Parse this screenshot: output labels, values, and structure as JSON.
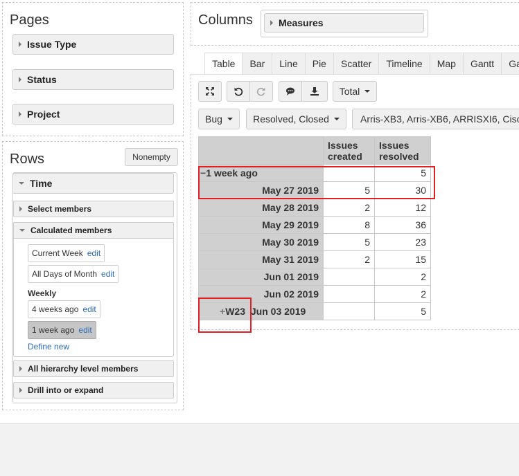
{
  "pages": {
    "title": "Pages",
    "dimensions": [
      "Issue Type",
      "Status",
      "Project"
    ]
  },
  "columns": {
    "title": "Columns",
    "measures_label": "Measures"
  },
  "rows": {
    "title": "Rows",
    "nonempty_label": "Nonempty",
    "time_label": "Time",
    "select_members_label": "Select members",
    "calculated_members_label": "Calculated members",
    "current_week": "Current Week",
    "all_days_of_month": "All Days of Month",
    "weekly_heading": "Weekly",
    "four_weeks_ago": "4 weeks ago",
    "one_week_ago": "1 week ago",
    "edit_label": "edit",
    "define_new": "Define new",
    "all_hierarchy_label": "All hierarchy level members",
    "drill_label": "Drill into or expand"
  },
  "tabs": [
    "Table",
    "Bar",
    "Line",
    "Pie",
    "Scatter",
    "Timeline",
    "Map",
    "Gantt",
    "Ga"
  ],
  "toolbar": {
    "total_label": "Total"
  },
  "filters": {
    "issue_type": "Bug",
    "status": "Resolved, Closed",
    "project": "Arris-XB3, Arris-XB6, ARRISXI6, Cisc"
  },
  "table": {
    "headers": [
      "Issues created",
      "Issues resolved"
    ],
    "header_lines": [
      [
        "Issues",
        "created"
      ],
      [
        "Issues",
        "resolved"
      ]
    ],
    "rows": [
      {
        "label": "1 week ago",
        "created": "",
        "resolved": "5"
      },
      {
        "label": "May 27 2019",
        "created": "5",
        "resolved": "30"
      },
      {
        "label": "May 28 2019",
        "created": "2",
        "resolved": "12"
      },
      {
        "label": "May 29 2019",
        "created": "8",
        "resolved": "36"
      },
      {
        "label": "May 30 2019",
        "created": "5",
        "resolved": "23"
      },
      {
        "label": "May 31 2019",
        "created": "2",
        "resolved": "15"
      },
      {
        "label": "Jun 01 2019",
        "created": "",
        "resolved": "2"
      },
      {
        "label": "Jun 02 2019",
        "created": "",
        "resolved": "2"
      },
      {
        "label": "Jun 03 2019",
        "week": "W23",
        "created": "",
        "resolved": "5"
      }
    ]
  },
  "colors": {
    "accent": "#2a6bb5",
    "highlight": "#e02020",
    "header_bg": "#d0d0d0"
  }
}
